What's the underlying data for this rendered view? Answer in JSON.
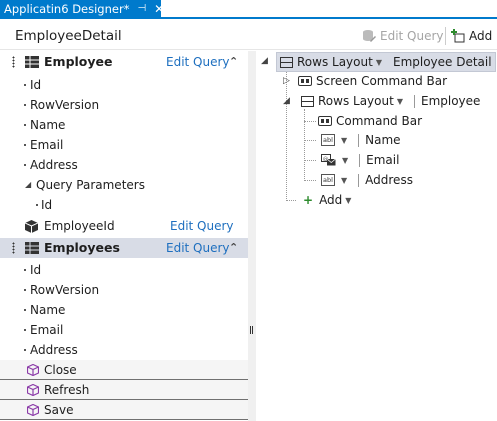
{
  "tab": {
    "title": "Applicatin6 Designer*",
    "pin": "⊣",
    "close": "✕"
  },
  "header": {
    "screen_title": "EmployeeDetail",
    "edit_query_label": "Edit Query",
    "add_label": "Add"
  },
  "left": {
    "employee": {
      "name": "Employee",
      "edit_query": "Edit Query",
      "props": [
        "Id",
        "RowVersion",
        "Name",
        "Email",
        "Address"
      ],
      "query_params_label": "Query Parameters",
      "query_param_id": "Id",
      "param_name": "EmployeeId",
      "param_edit_query": "Edit Query"
    },
    "employees": {
      "name": "Employees",
      "edit_query": "Edit Query",
      "props": [
        "Id",
        "RowVersion",
        "Name",
        "Email",
        "Address"
      ]
    },
    "commands": [
      "Close",
      "Refresh",
      "Save"
    ]
  },
  "tree": {
    "root_layout": "Rows Layout",
    "root_target": "Employee Detail",
    "screen_command_bar": "Screen Command Bar",
    "rows_layout": "Rows Layout",
    "rows_target": "Employee",
    "command_bar": "Command Bar",
    "fields": [
      "Name",
      "Email",
      "Address"
    ],
    "add_label": "Add"
  }
}
